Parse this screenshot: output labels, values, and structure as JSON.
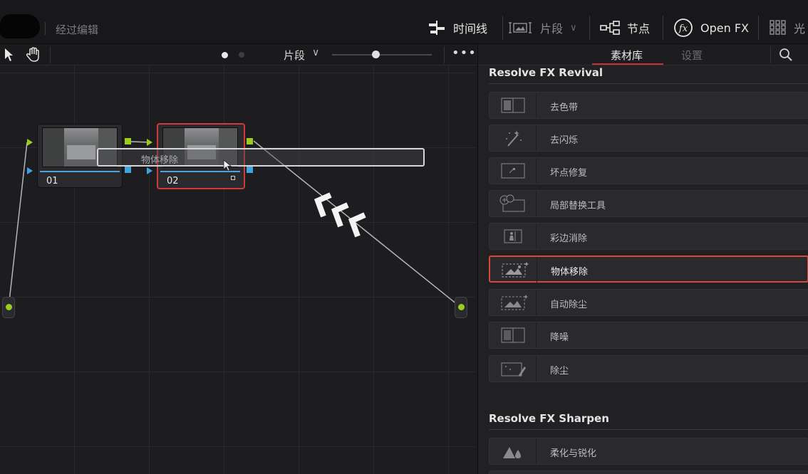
{
  "topbar": {
    "project_name": "经过编辑",
    "timeline_label": "时间线",
    "clips_label": "片段",
    "nodes_label": "节点",
    "openfx_label": "Open FX",
    "light_label": "光"
  },
  "node_editor": {
    "mode_label": "片段",
    "nodes": [
      {
        "num": "01"
      },
      {
        "num": "02"
      }
    ],
    "drag_label": "物体移除"
  },
  "panel": {
    "tabs": [
      {
        "label": "素材库"
      },
      {
        "label": "设置"
      }
    ],
    "sections": [
      {
        "title": "Resolve FX Revival",
        "items": [
          {
            "label": "去色带",
            "icon": "split-frame-icon"
          },
          {
            "label": "去闪烁",
            "icon": "sparkle-wand-icon"
          },
          {
            "label": "坏点修复",
            "icon": "dead-pixel-icon"
          },
          {
            "label": "局部替换工具",
            "icon": "patch-replace-icon"
          },
          {
            "label": "彩边消除",
            "icon": "chromatic-icon"
          },
          {
            "label": "物体移除",
            "icon": "object-removal-icon"
          },
          {
            "label": "自动除尘",
            "icon": "auto-dust-icon"
          },
          {
            "label": "降噪",
            "icon": "split-frame-icon"
          },
          {
            "label": "除尘",
            "icon": "dust-brush-icon"
          }
        ]
      },
      {
        "title": "Resolve FX Sharpen",
        "items": [
          {
            "label": "柔化与锐化",
            "icon": "mountain-drop-icon"
          }
        ]
      }
    ]
  },
  "colors": {
    "accent_red": "#d9473a",
    "node_green": "#9bcc1e",
    "node_blue": "#3ea5e0"
  }
}
